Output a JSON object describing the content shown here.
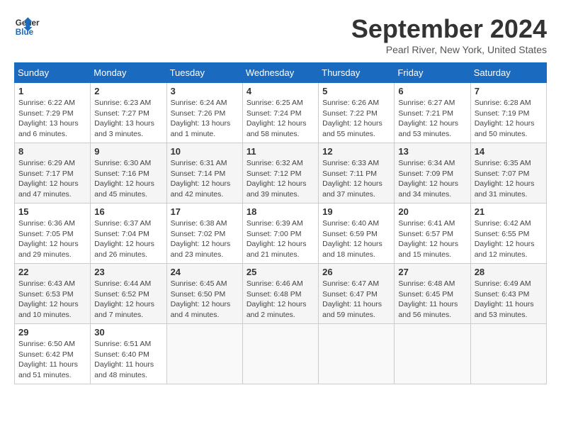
{
  "header": {
    "logo_line1": "General",
    "logo_line2": "Blue",
    "month_title": "September 2024",
    "location": "Pearl River, New York, United States"
  },
  "weekdays": [
    "Sunday",
    "Monday",
    "Tuesday",
    "Wednesday",
    "Thursday",
    "Friday",
    "Saturday"
  ],
  "weeks": [
    [
      {
        "day": "1",
        "sunrise": "Sunrise: 6:22 AM",
        "sunset": "Sunset: 7:29 PM",
        "daylight": "Daylight: 13 hours and 6 minutes."
      },
      {
        "day": "2",
        "sunrise": "Sunrise: 6:23 AM",
        "sunset": "Sunset: 7:27 PM",
        "daylight": "Daylight: 13 hours and 3 minutes."
      },
      {
        "day": "3",
        "sunrise": "Sunrise: 6:24 AM",
        "sunset": "Sunset: 7:26 PM",
        "daylight": "Daylight: 13 hours and 1 minute."
      },
      {
        "day": "4",
        "sunrise": "Sunrise: 6:25 AM",
        "sunset": "Sunset: 7:24 PM",
        "daylight": "Daylight: 12 hours and 58 minutes."
      },
      {
        "day": "5",
        "sunrise": "Sunrise: 6:26 AM",
        "sunset": "Sunset: 7:22 PM",
        "daylight": "Daylight: 12 hours and 55 minutes."
      },
      {
        "day": "6",
        "sunrise": "Sunrise: 6:27 AM",
        "sunset": "Sunset: 7:21 PM",
        "daylight": "Daylight: 12 hours and 53 minutes."
      },
      {
        "day": "7",
        "sunrise": "Sunrise: 6:28 AM",
        "sunset": "Sunset: 7:19 PM",
        "daylight": "Daylight: 12 hours and 50 minutes."
      }
    ],
    [
      {
        "day": "8",
        "sunrise": "Sunrise: 6:29 AM",
        "sunset": "Sunset: 7:17 PM",
        "daylight": "Daylight: 12 hours and 47 minutes."
      },
      {
        "day": "9",
        "sunrise": "Sunrise: 6:30 AM",
        "sunset": "Sunset: 7:16 PM",
        "daylight": "Daylight: 12 hours and 45 minutes."
      },
      {
        "day": "10",
        "sunrise": "Sunrise: 6:31 AM",
        "sunset": "Sunset: 7:14 PM",
        "daylight": "Daylight: 12 hours and 42 minutes."
      },
      {
        "day": "11",
        "sunrise": "Sunrise: 6:32 AM",
        "sunset": "Sunset: 7:12 PM",
        "daylight": "Daylight: 12 hours and 39 minutes."
      },
      {
        "day": "12",
        "sunrise": "Sunrise: 6:33 AM",
        "sunset": "Sunset: 7:11 PM",
        "daylight": "Daylight: 12 hours and 37 minutes."
      },
      {
        "day": "13",
        "sunrise": "Sunrise: 6:34 AM",
        "sunset": "Sunset: 7:09 PM",
        "daylight": "Daylight: 12 hours and 34 minutes."
      },
      {
        "day": "14",
        "sunrise": "Sunrise: 6:35 AM",
        "sunset": "Sunset: 7:07 PM",
        "daylight": "Daylight: 12 hours and 31 minutes."
      }
    ],
    [
      {
        "day": "15",
        "sunrise": "Sunrise: 6:36 AM",
        "sunset": "Sunset: 7:05 PM",
        "daylight": "Daylight: 12 hours and 29 minutes."
      },
      {
        "day": "16",
        "sunrise": "Sunrise: 6:37 AM",
        "sunset": "Sunset: 7:04 PM",
        "daylight": "Daylight: 12 hours and 26 minutes."
      },
      {
        "day": "17",
        "sunrise": "Sunrise: 6:38 AM",
        "sunset": "Sunset: 7:02 PM",
        "daylight": "Daylight: 12 hours and 23 minutes."
      },
      {
        "day": "18",
        "sunrise": "Sunrise: 6:39 AM",
        "sunset": "Sunset: 7:00 PM",
        "daylight": "Daylight: 12 hours and 21 minutes."
      },
      {
        "day": "19",
        "sunrise": "Sunrise: 6:40 AM",
        "sunset": "Sunset: 6:59 PM",
        "daylight": "Daylight: 12 hours and 18 minutes."
      },
      {
        "day": "20",
        "sunrise": "Sunrise: 6:41 AM",
        "sunset": "Sunset: 6:57 PM",
        "daylight": "Daylight: 12 hours and 15 minutes."
      },
      {
        "day": "21",
        "sunrise": "Sunrise: 6:42 AM",
        "sunset": "Sunset: 6:55 PM",
        "daylight": "Daylight: 12 hours and 12 minutes."
      }
    ],
    [
      {
        "day": "22",
        "sunrise": "Sunrise: 6:43 AM",
        "sunset": "Sunset: 6:53 PM",
        "daylight": "Daylight: 12 hours and 10 minutes."
      },
      {
        "day": "23",
        "sunrise": "Sunrise: 6:44 AM",
        "sunset": "Sunset: 6:52 PM",
        "daylight": "Daylight: 12 hours and 7 minutes."
      },
      {
        "day": "24",
        "sunrise": "Sunrise: 6:45 AM",
        "sunset": "Sunset: 6:50 PM",
        "daylight": "Daylight: 12 hours and 4 minutes."
      },
      {
        "day": "25",
        "sunrise": "Sunrise: 6:46 AM",
        "sunset": "Sunset: 6:48 PM",
        "daylight": "Daylight: 12 hours and 2 minutes."
      },
      {
        "day": "26",
        "sunrise": "Sunrise: 6:47 AM",
        "sunset": "Sunset: 6:47 PM",
        "daylight": "Daylight: 11 hours and 59 minutes."
      },
      {
        "day": "27",
        "sunrise": "Sunrise: 6:48 AM",
        "sunset": "Sunset: 6:45 PM",
        "daylight": "Daylight: 11 hours and 56 minutes."
      },
      {
        "day": "28",
        "sunrise": "Sunrise: 6:49 AM",
        "sunset": "Sunset: 6:43 PM",
        "daylight": "Daylight: 11 hours and 53 minutes."
      }
    ],
    [
      {
        "day": "29",
        "sunrise": "Sunrise: 6:50 AM",
        "sunset": "Sunset: 6:42 PM",
        "daylight": "Daylight: 11 hours and 51 minutes."
      },
      {
        "day": "30",
        "sunrise": "Sunrise: 6:51 AM",
        "sunset": "Sunset: 6:40 PM",
        "daylight": "Daylight: 11 hours and 48 minutes."
      },
      null,
      null,
      null,
      null,
      null
    ]
  ]
}
